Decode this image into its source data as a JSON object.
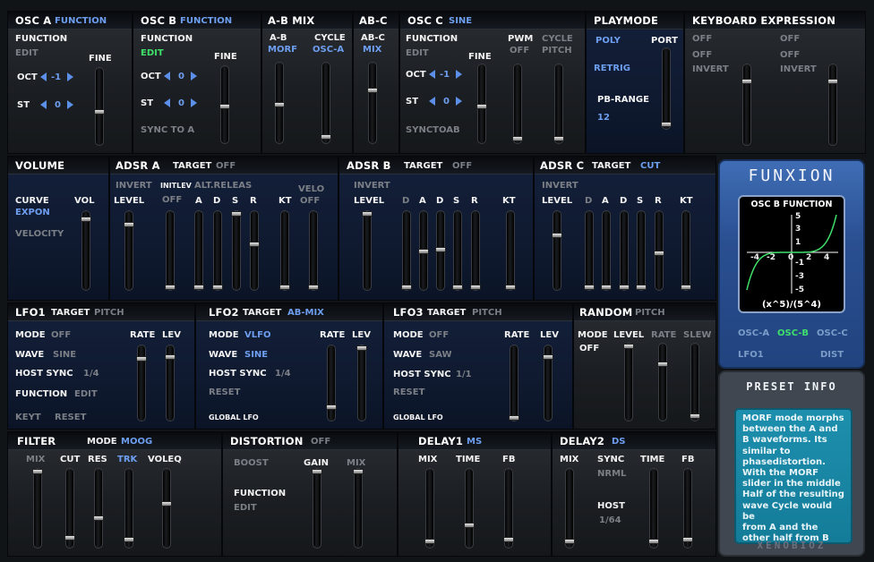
{
  "osc_a": {
    "title": "OSC A",
    "mode": "FUNCTION",
    "function": "FUNCTION",
    "edit": "EDIT",
    "fine": "FINE",
    "oct": "OCT",
    "oct_val": "-1",
    "st": "ST",
    "st_val": "0"
  },
  "osc_b": {
    "title": "OSC B",
    "mode": "FUNCTION",
    "function": "FUNCTION",
    "edit": "EDIT",
    "fine": "FINE",
    "oct": "OCT",
    "oct_val": "0",
    "st": "ST",
    "st_val": "0",
    "sync": "SYNC TO A"
  },
  "ab_mix": {
    "title": "A-B MIX",
    "ab": "A-B",
    "morf": "MORF",
    "cycle": "CYCLE",
    "cycle_val": "OSC-A"
  },
  "ab_c": {
    "title": "AB-C",
    "ab_c": "AB-C",
    "mix": "MIX"
  },
  "osc_c": {
    "title": "OSC C",
    "mode": "SINE",
    "function": "FUNCTION",
    "edit": "EDIT",
    "fine": "FINE",
    "pwm": "PWM",
    "pwm_val": "OFF",
    "cycle": "CYCLE",
    "pitch": "PITCH",
    "oct": "OCT",
    "oct_val": "-1",
    "st": "ST",
    "st_val": "0",
    "sync": "SYNCTOAB"
  },
  "playmode": {
    "title": "PLAYMODE",
    "poly": "POLY",
    "port": "PORT",
    "retrig": "RETRIG",
    "pb": "PB-RANGE",
    "pb_val": "12"
  },
  "keyexp": {
    "title": "KEYBOARD EXPRESSION",
    "off1": "OFF",
    "off2": "OFF",
    "off3": "OFF",
    "off4": "OFF",
    "invert1": "INVERT",
    "invert2": "INVERT"
  },
  "volume": {
    "title": "VOLUME",
    "curve": "CURVE",
    "curve_val": "EXPON",
    "vol": "VOL",
    "velocity": "VELOCITY"
  },
  "adsr_a": {
    "title": "ADSR A",
    "target": "TARGET",
    "target_val": "OFF",
    "invert": "INVERT",
    "initlev": "INITLEV",
    "altrel": "ALT.RELEAS",
    "velo": "VELO",
    "level": "LEVEL",
    "off": "OFF",
    "velo_val": "OFF",
    "a": "A",
    "d": "D",
    "s": "S",
    "r": "R",
    "kt": "KT"
  },
  "adsr_b": {
    "title": "ADSR B",
    "target": "TARGET",
    "target_val": "OFF",
    "invert": "INVERT",
    "level": "LEVEL",
    "d1": "D",
    "a": "A",
    "d2": "D",
    "s": "S",
    "r": "R",
    "kt": "KT"
  },
  "adsr_c": {
    "title": "ADSR C",
    "target": "TARGET",
    "target_val": "CUT",
    "invert": "INVERT",
    "level": "LEVEL",
    "d1": "D",
    "a": "A",
    "d2": "D",
    "s": "S",
    "r": "R",
    "kt": "KT"
  },
  "logo": {
    "name": "FUNXION",
    "scope_title": "OSC B FUNCTION",
    "y_ticks": [
      "5",
      "3",
      "1",
      "-1",
      "-3",
      "-5"
    ],
    "x_ticks": [
      "-4",
      "-2",
      "0",
      "2",
      "4"
    ],
    "formula": "(x^5)/(5^4)",
    "osc_a": "OSC-A",
    "osc_b": "OSC-B",
    "osc_c": "OSC-C",
    "lfo1": "LFO1",
    "dist": "DIST",
    "colors": {
      "curve": "#3fe06a",
      "active": "#3fe06a"
    }
  },
  "lfo1": {
    "title": "LFO1",
    "target": "TARGET",
    "target_val": "PITCH",
    "mode": "MODE",
    "mode_val": "OFF",
    "rate": "RATE",
    "lev": "LEV",
    "wave": "WAVE",
    "wave_val": "SINE",
    "hostsync": "HOST SYNC",
    "hs_val": "1/4",
    "function": "FUNCTION",
    "edit": "EDIT",
    "keyt": "KEYT",
    "reset": "RESET"
  },
  "lfo2": {
    "title": "LFO2",
    "target": "TARGET",
    "target_val": "AB-MIX",
    "mode": "MODE",
    "mode_val": "VLFO",
    "rate": "RATE",
    "lev": "LEV",
    "wave": "WAVE",
    "wave_val": "SINE",
    "hostsync": "HOST SYNC",
    "hs_val": "1/4",
    "reset": "RESET",
    "global": "GLOBAL LFO"
  },
  "lfo3": {
    "title": "LFO3",
    "target": "TARGET",
    "target_val": "PITCH",
    "mode": "MODE",
    "mode_val": "OFF",
    "rate": "RATE",
    "lev": "LEV",
    "wave": "WAVE",
    "wave_val": "SAW",
    "hostsync": "HOST SYNC",
    "hs_val": "1/1",
    "reset": "RESET",
    "global": "GLOBAL LFO"
  },
  "random": {
    "title": "RANDOM",
    "target_val": "PITCH",
    "mode": "MODE",
    "mode_val": "OFF",
    "level": "LEVEL",
    "rate": "RATE",
    "slew": "SLEW"
  },
  "filter": {
    "title": "FILTER",
    "mode": "MODE",
    "mode_val": "MOOG",
    "mix": "MIX",
    "cut": "CUT",
    "res": "RES",
    "trk": "TRK",
    "voleq": "VOLEQ"
  },
  "distortion": {
    "title": "DISTORTION",
    "status": "OFF",
    "boost": "BOOST",
    "gain": "GAIN",
    "mix": "MIX",
    "function": "FUNCTION",
    "edit": "EDIT"
  },
  "delay1": {
    "title": "DELAY1",
    "mode": "MS",
    "mix": "MIX",
    "time": "TIME",
    "fb": "FB"
  },
  "delay2": {
    "title": "DELAY2",
    "mode": "DS",
    "mix": "MIX",
    "sync": "SYNC",
    "sync_val": "NRML",
    "time": "TIME",
    "fb": "FB",
    "host": "HOST",
    "host_val": "1/64"
  },
  "preset": {
    "title": "PRESET INFO",
    "text": "MORF mode morphs\nbetween the A and\nB waveforms. Its\nsimilar to\nphasedistortion.\nWith the MORF\nslider in the middle\nHalf of the resulting\nwave Cycle would be\nfrom A and the\nother half from B",
    "footer": "XENOBIOZ"
  }
}
